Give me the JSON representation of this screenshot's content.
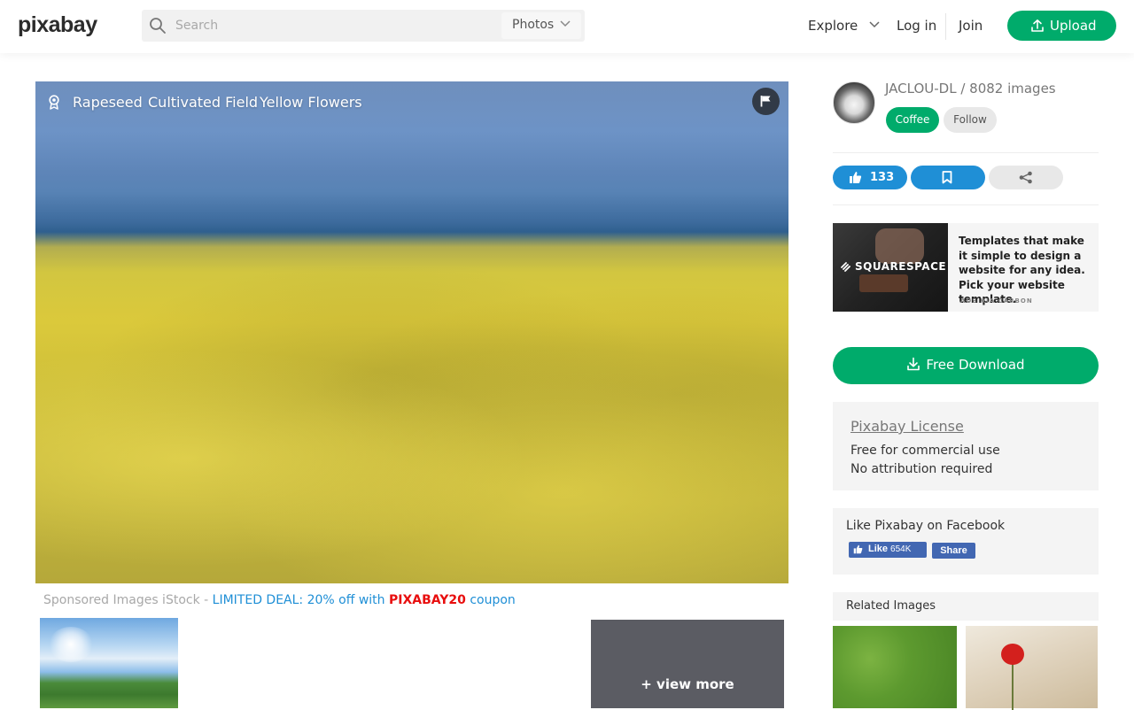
{
  "header": {
    "logo": "pixabay",
    "search_placeholder": "Search",
    "media_type": "Photos",
    "nav": {
      "explore": "Explore",
      "login": "Log in",
      "join": "Join",
      "upload": "Upload"
    }
  },
  "image": {
    "tags": [
      "Rapeseed",
      "Cultivated Field",
      "Yellow Flowers"
    ]
  },
  "sponsored": {
    "prefix": "Sponsored Images iStock - ",
    "deal": "LIMITED DEAL: 20% off with ",
    "code": "PIXABAY20",
    "suffix": " coupon",
    "view_more": "+ view more"
  },
  "sidebar": {
    "author": "JACLOU-DL / 8082 images",
    "coffee": "Coffee",
    "follow": "Follow",
    "likes": "133",
    "ad": {
      "brand": "SQUARESPACE",
      "text": "Templates that make it simple to design a website for any idea. Pick your website template.",
      "via": "ADS VIA CARBON"
    },
    "download": "Free Download",
    "license": {
      "title": "Pixabay License",
      "lines": [
        "Free for commercial use",
        "No attribution required"
      ]
    },
    "facebook": {
      "title": "Like Pixabay on Facebook",
      "like": "Like",
      "count": "654K",
      "share": "Share"
    },
    "related_title": "Related Images"
  },
  "colors": {
    "accent_green": "#00ab6b",
    "accent_blue": "#1f8fd6",
    "deal_red": "#e80e0e",
    "facebook_blue": "#4267b2"
  }
}
